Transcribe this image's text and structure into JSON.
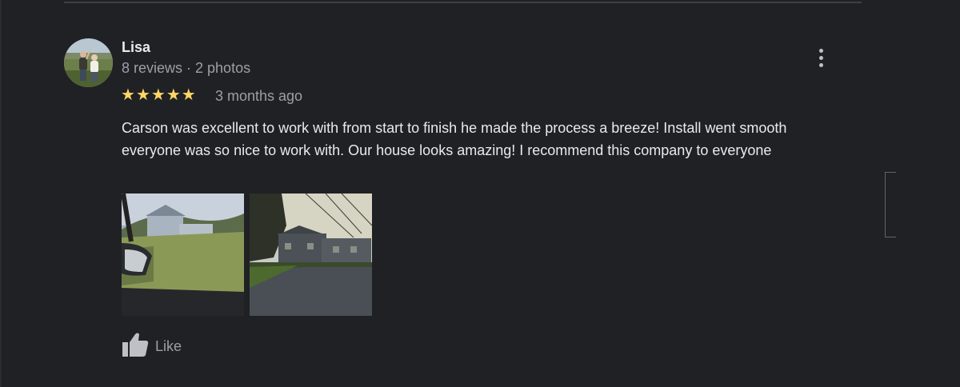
{
  "review": {
    "author": {
      "name": "Lisa",
      "meta": "8 reviews · 2 photos"
    },
    "rating": 5,
    "rating_stars": "★★★★★",
    "time": "3 months ago",
    "text": "Carson was excellent to work with from start to finish he made the process a breeze! Install went smooth everyone was so nice to work with. Our house looks amazing! I recommend this company to everyone",
    "photo_count": 2,
    "like_label": "Like"
  },
  "icons": {
    "more": "more-vert-icon",
    "like": "thumbs-up-icon",
    "star": "star-icon"
  },
  "colors": {
    "background": "#202124",
    "star": "#fdd663",
    "primary_text": "#e8eaed",
    "secondary_text": "#9aa0a6"
  }
}
